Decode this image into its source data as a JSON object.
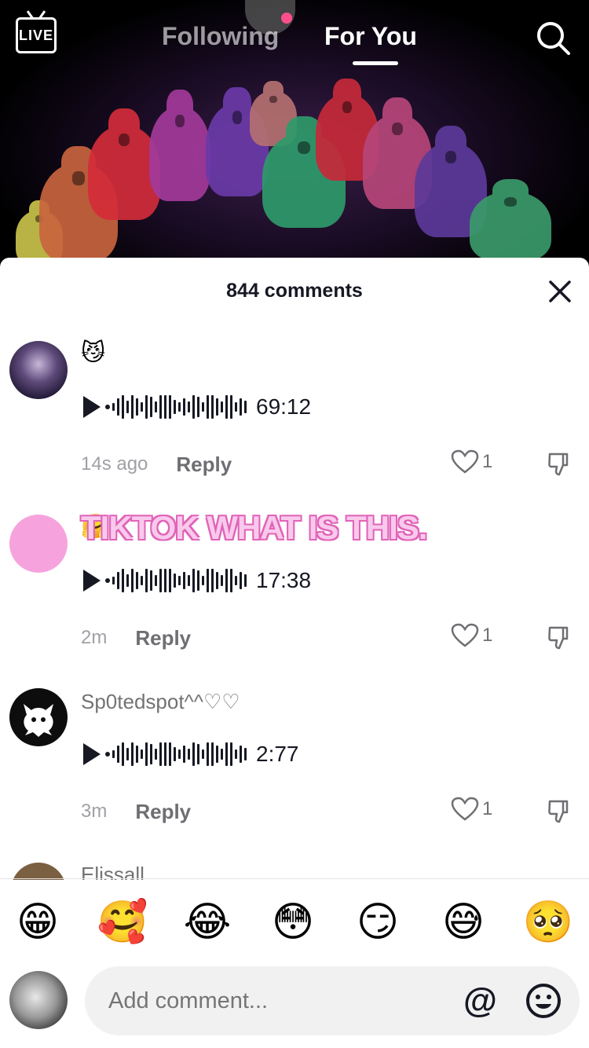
{
  "nav": {
    "live_label": "LIVE",
    "tabs": [
      {
        "label": "Following",
        "active": false
      },
      {
        "label": "For You",
        "active": true
      }
    ]
  },
  "comments_header": {
    "count_label": "844 comments"
  },
  "comments": [
    {
      "username": "",
      "text": "😼",
      "audio_duration": "69:12",
      "time": "14s ago",
      "reply_label": "Reply",
      "likes": "1"
    },
    {
      "username": "",
      "text": "🤗",
      "overlay_text": "TIKTOK WHAT IS THIS.",
      "audio_duration": "17:38",
      "time": "2m",
      "reply_label": "Reply",
      "likes": "1"
    },
    {
      "username": "Sp0tedspot^^♡♡",
      "text": "",
      "audio_duration": "2:77",
      "time": "3m",
      "reply_label": "Reply",
      "likes": "1"
    },
    {
      "username": "Elissall"
    }
  ],
  "emoji_bar": [
    "😁",
    "🥰",
    "😂",
    "😳",
    "😏",
    "😅",
    "🥺"
  ],
  "input": {
    "placeholder": "Add comment...",
    "mention_label": "@"
  },
  "colors": {
    "accent_pink": "#f9c9ec",
    "text_primary": "#161823",
    "text_secondary": "#737373"
  }
}
